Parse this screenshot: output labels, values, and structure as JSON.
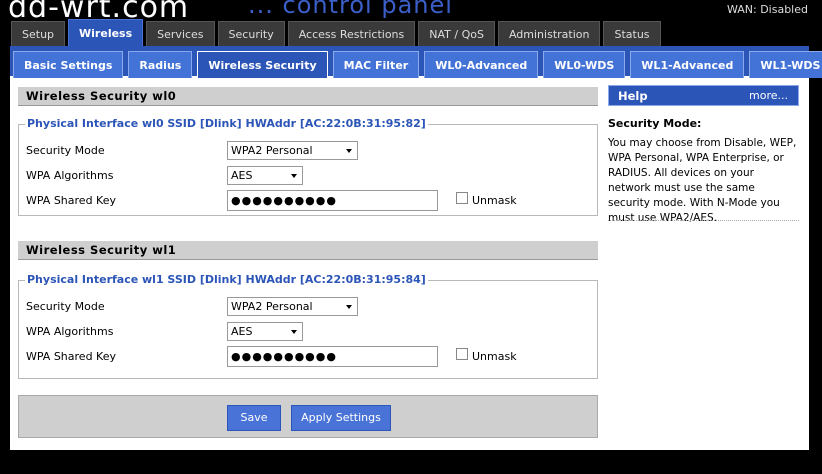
{
  "header": {
    "logo": "dd-wrt.com",
    "subtitle": "... control panel",
    "wan_status": "WAN: Disabled"
  },
  "top_tabs": [
    "Setup",
    "Wireless",
    "Services",
    "Security",
    "Access Restrictions",
    "NAT / QoS",
    "Administration",
    "Status"
  ],
  "sub_tabs": [
    "Basic Settings",
    "Radius",
    "Wireless Security",
    "MAC Filter",
    "WL0-Advanced",
    "WL0-WDS",
    "WL1-Advanced",
    "WL1-WDS"
  ],
  "sections": [
    {
      "title": "Wireless Security wl0",
      "legend": "Physical Interface wl0 SSID [Dlink] HWAddr [AC:22:0B:31:95:82]",
      "security_mode_label": "Security Mode",
      "security_mode_value": "WPA2 Personal",
      "wpa_algorithms_label": "WPA Algorithms",
      "wpa_algorithms_value": "AES",
      "wpa_key_label": "WPA Shared Key",
      "wpa_key_value": "●●●●●●●●●●",
      "unmask_label": "Unmask"
    },
    {
      "title": "Wireless Security wl1",
      "legend": "Physical Interface wl1 SSID [Dlink] HWAddr [AC:22:0B:31:95:84]",
      "security_mode_label": "Security Mode",
      "security_mode_value": "WPA2 Personal",
      "wpa_algorithms_label": "WPA Algorithms",
      "wpa_algorithms_value": "AES",
      "wpa_key_label": "WPA Shared Key",
      "wpa_key_value": "●●●●●●●●●●",
      "unmask_label": "Unmask"
    }
  ],
  "buttons": {
    "save": "Save",
    "apply": "Apply Settings"
  },
  "help": {
    "title": "Help",
    "more": "more...",
    "heading": "Security Mode:",
    "text": "You may choose from Disable, WEP, WPA Personal, WPA Enterprise, or RADIUS. All devices on your network must use the same security mode. With N-Mode you must use WPA2/AES."
  },
  "colors": {
    "accent": "#2c55b8",
    "tab_bg": "#3a3a3a",
    "panel_grey": "#cfcfcf"
  }
}
